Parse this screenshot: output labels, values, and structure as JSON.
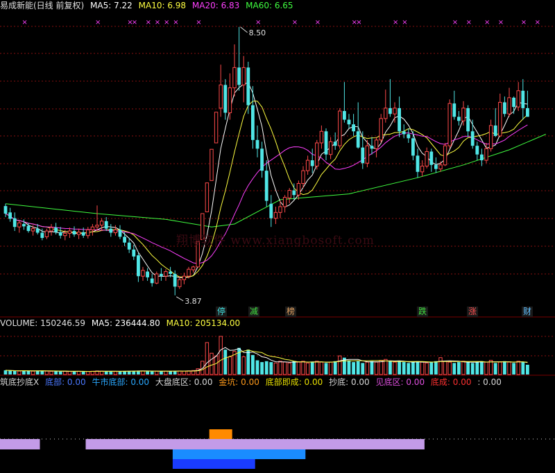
{
  "header1": {
    "name": "易成新能(日线 前复权)",
    "ma5": "MA5: 7.22",
    "ma10": "MA10: 6.98",
    "ma20": "MA20: 6.83",
    "ma60": "MA60: 6.65"
  },
  "header2": {
    "volume": "VOLUME: 150246.59",
    "ma5": "MA5: 236444.80",
    "ma10": "MA10: 205134.00"
  },
  "header3": [
    {
      "text": "筑底抄底X",
      "color": "#d8d8d8"
    },
    {
      "text": "底部: 0.00",
      "color": "#4a78ff"
    },
    {
      "text": "牛市底部: 0.00",
      "color": "#2aa8ff"
    },
    {
      "text": "大盘底区: 0.00",
      "color": "#d8d8d8"
    },
    {
      "text": "金坑: 0.00",
      "color": "#ff9a1a"
    },
    {
      "text": "底部即成: 0.00",
      "color": "#e8e000"
    },
    {
      "text": "抄底: 0.00",
      "color": "#d8d8d8"
    },
    {
      "text": "见底区: 0.00",
      "color": "#e050e0"
    },
    {
      "text": "底成: 0.00",
      "color": "#ff3030"
    },
    {
      "text": ": 0.00",
      "color": "#d8d8d8"
    }
  ],
  "watermark": "翔博软件 www.xiangbosoft.com",
  "annotations": {
    "high": "8.50",
    "low": "3.87"
  },
  "tags": [
    {
      "text": "停",
      "color": "#40e0e0"
    },
    {
      "text": "减",
      "color": "#40e040"
    },
    {
      "text": "榜",
      "color": "#e0a060"
    },
    {
      "text": "跌",
      "color": "#40e040"
    },
    {
      "text": "涨",
      "color": "#ff5050"
    },
    {
      "text": "财",
      "color": "#60c0ff"
    }
  ],
  "colors": {
    "up": "#ff4a4a",
    "down": "#50e6e6",
    "ma5": "#ffffff",
    "ma10": "#ffff40",
    "ma20": "#ff40ff",
    "ma60": "#40ff40",
    "grid": "#8a1010",
    "lavender": "#c39be8",
    "orange": "#ff8a00",
    "blue1": "#1a8cff",
    "blue2": "#1a3cff"
  },
  "chart_data": {
    "type": "candlestick",
    "title": "易成新能(日线 前复权)",
    "high_label": 8.5,
    "low_label": 3.87,
    "ylim": [
      3.7,
      8.75
    ],
    "candles": [
      [
        5.41,
        5.45,
        5.22,
        5.28
      ],
      [
        5.3,
        5.38,
        5.14,
        5.19
      ],
      [
        5.2,
        5.3,
        4.98,
        5.05
      ],
      [
        5.05,
        5.16,
        4.95,
        5.12
      ],
      [
        5.1,
        5.18,
        5.0,
        5.06
      ],
      [
        5.07,
        5.12,
        4.95,
        4.98
      ],
      [
        4.98,
        5.08,
        4.9,
        5.02
      ],
      [
        5.02,
        5.1,
        4.92,
        4.95
      ],
      [
        4.95,
        5.02,
        4.82,
        4.86
      ],
      [
        4.88,
        5.02,
        4.84,
        4.98
      ],
      [
        4.98,
        5.1,
        4.9,
        5.04
      ],
      [
        5.04,
        5.12,
        4.92,
        4.96
      ],
      [
        4.96,
        5.05,
        4.85,
        4.9
      ],
      [
        4.9,
        5.0,
        4.82,
        4.94
      ],
      [
        4.94,
        5.04,
        4.86,
        4.98
      ],
      [
        4.98,
        5.06,
        4.88,
        4.92
      ],
      [
        4.92,
        5.02,
        4.84,
        4.96
      ],
      [
        4.96,
        5.04,
        4.86,
        4.9
      ],
      [
        4.9,
        5.05,
        4.85,
        5.0
      ],
      [
        5.0,
        5.1,
        4.9,
        5.05
      ],
      [
        5.05,
        5.42,
        4.98,
        5.08
      ],
      [
        5.08,
        5.2,
        4.98,
        5.15
      ],
      [
        5.15,
        5.22,
        4.98,
        5.02
      ],
      [
        5.02,
        5.1,
        4.88,
        4.95
      ],
      [
        4.95,
        5.08,
        4.9,
        5.0
      ],
      [
        5.0,
        5.08,
        4.84,
        4.88
      ],
      [
        4.88,
        4.96,
        4.72,
        4.78
      ],
      [
        4.78,
        4.86,
        4.6,
        4.66
      ],
      [
        4.66,
        4.74,
        4.48,
        4.54
      ],
      [
        4.56,
        4.6,
        4.1,
        4.2
      ],
      [
        4.2,
        4.36,
        4.12,
        4.3
      ],
      [
        4.28,
        4.34,
        4.12,
        4.18
      ],
      [
        4.16,
        4.24,
        4.02,
        4.08
      ],
      [
        4.08,
        4.28,
        4.06,
        4.24
      ],
      [
        4.24,
        4.34,
        4.12,
        4.2
      ],
      [
        4.2,
        4.32,
        4.12,
        4.28
      ],
      [
        4.28,
        4.36,
        4.18,
        4.24
      ],
      [
        4.24,
        4.3,
        3.87,
        4.02
      ],
      [
        4.02,
        4.2,
        3.98,
        4.14
      ],
      [
        4.14,
        4.26,
        4.06,
        4.2
      ],
      [
        4.2,
        4.36,
        4.16,
        4.32
      ],
      [
        4.31,
        4.38,
        4.26,
        4.36
      ],
      [
        4.36,
        4.8,
        4.35,
        4.8
      ],
      [
        4.83,
        5.28,
        4.83,
        5.28
      ],
      [
        5.31,
        5.81,
        5.31,
        5.81
      ],
      [
        5.85,
        6.39,
        5.85,
        6.39
      ],
      [
        6.5,
        7.03,
        6.5,
        7.03
      ],
      [
        7.1,
        7.85,
        6.95,
        7.5
      ],
      [
        7.5,
        7.6,
        6.9,
        7.02
      ],
      [
        7.02,
        7.7,
        6.9,
        7.45
      ],
      [
        7.45,
        8.2,
        7.3,
        7.8
      ],
      [
        7.8,
        8.5,
        7.4,
        7.5
      ],
      [
        7.5,
        8.0,
        7.2,
        7.8
      ],
      [
        7.8,
        7.9,
        7.0,
        7.15
      ],
      [
        7.15,
        7.48,
        6.4,
        6.55
      ],
      [
        6.55,
        6.8,
        6.25,
        6.4
      ],
      [
        6.4,
        6.52,
        5.9,
        6.02
      ],
      [
        6.02,
        6.2,
        5.4,
        5.5
      ],
      [
        5.45,
        5.6,
        5.05,
        5.2
      ],
      [
        5.2,
        5.4,
        5.1,
        5.3
      ],
      [
        5.3,
        5.5,
        5.2,
        5.4
      ],
      [
        5.4,
        5.6,
        5.3,
        5.56
      ],
      [
        5.55,
        5.72,
        5.46,
        5.68
      ],
      [
        5.68,
        5.8,
        5.52,
        5.6
      ],
      [
        5.6,
        5.85,
        5.52,
        5.8
      ],
      [
        5.8,
        6.1,
        5.72,
        6.02
      ],
      [
        6.02,
        6.28,
        5.95,
        6.2
      ],
      [
        6.2,
        6.4,
        5.98,
        6.1
      ],
      [
        6.1,
        6.55,
        6.04,
        6.5
      ],
      [
        6.5,
        6.8,
        6.4,
        6.7
      ],
      [
        6.7,
        6.75,
        6.2,
        6.3
      ],
      [
        6.3,
        6.6,
        6.22,
        6.52
      ],
      [
        6.52,
        6.68,
        6.38,
        6.45
      ],
      [
        6.45,
        7.1,
        6.4,
        7.05
      ],
      [
        7.05,
        7.55,
        6.85,
        6.9
      ],
      [
        6.9,
        7.0,
        6.75,
        6.82
      ],
      [
        6.82,
        7.0,
        6.62,
        6.7
      ],
      [
        6.7,
        7.2,
        6.4,
        6.42
      ],
      [
        6.42,
        6.7,
        6.05,
        6.15
      ],
      [
        6.15,
        6.55,
        6.08,
        6.45
      ],
      [
        6.45,
        6.6,
        6.3,
        6.4
      ],
      [
        6.4,
        6.6,
        6.25,
        6.55
      ],
      [
        6.55,
        7.0,
        6.5,
        6.92
      ],
      [
        6.92,
        7.42,
        6.85,
        7.1
      ],
      [
        7.1,
        7.6,
        6.95,
        7.0
      ],
      [
        7.0,
        7.2,
        6.85,
        7.1
      ],
      [
        7.1,
        7.3,
        6.6,
        6.7
      ],
      [
        6.7,
        6.82,
        6.58,
        6.65
      ],
      [
        6.65,
        6.75,
        6.5,
        6.58
      ],
      [
        6.58,
        6.7,
        6.2,
        6.28
      ],
      [
        6.28,
        6.4,
        5.9,
        6.0
      ],
      [
        6.0,
        6.2,
        5.92,
        6.1
      ],
      [
        6.1,
        6.42,
        6.06,
        6.35
      ],
      [
        6.35,
        6.4,
        6.0,
        6.12
      ],
      [
        6.12,
        6.25,
        5.98,
        6.05
      ],
      [
        6.05,
        6.18,
        6.0,
        6.12
      ],
      [
        6.12,
        6.5,
        6.1,
        6.45
      ],
      [
        6.45,
        7.25,
        6.4,
        7.18
      ],
      [
        7.18,
        7.4,
        6.9,
        6.95
      ],
      [
        6.95,
        7.05,
        6.8,
        6.88
      ],
      [
        6.88,
        7.22,
        6.8,
        7.1
      ],
      [
        7.1,
        7.15,
        6.6,
        6.7
      ],
      [
        6.7,
        6.9,
        6.4,
        6.45
      ],
      [
        6.45,
        6.52,
        6.2,
        6.3
      ],
      [
        6.3,
        6.4,
        6.1,
        6.2
      ],
      [
        6.2,
        6.5,
        6.15,
        6.4
      ],
      [
        6.4,
        6.9,
        6.35,
        6.8
      ],
      [
        6.8,
        7.1,
        6.6,
        6.62
      ],
      [
        6.62,
        7.35,
        6.6,
        7.2
      ],
      [
        7.2,
        7.3,
        6.95,
        7.0
      ],
      [
        7.0,
        7.45,
        6.95,
        7.28
      ],
      [
        7.28,
        7.3,
        7.0,
        7.12
      ],
      [
        7.12,
        7.55,
        7.05,
        7.4
      ],
      [
        7.4,
        7.6,
        6.9,
        7.1
      ],
      [
        7.1,
        7.4,
        7.0,
        6.95
      ]
    ],
    "ma60_points": [
      [
        0,
        5.45
      ],
      [
        20,
        5.28
      ],
      [
        35,
        5.18
      ],
      [
        45,
        5.05
      ],
      [
        50,
        5.1
      ],
      [
        60,
        5.52
      ],
      [
        75,
        5.62
      ],
      [
        90,
        5.9
      ],
      [
        100,
        6.12
      ],
      [
        110,
        6.38
      ],
      [
        118,
        6.65
      ]
    ],
    "volume": {
      "label": "VOLUME",
      "last": 150246.59,
      "ma5": 236444.8,
      "ma10": 205134.0,
      "ymax": 1000,
      "values": [
        95,
        85,
        80,
        78,
        90,
        82,
        75,
        80,
        88,
        76,
        72,
        70,
        68,
        74,
        70,
        66,
        72,
        68,
        70,
        74,
        80,
        76,
        72,
        70,
        68,
        74,
        78,
        80,
        82,
        86,
        78,
        72,
        70,
        74,
        72,
        76,
        78,
        84,
        80,
        76,
        82,
        90,
        130,
        300,
        720,
        480,
        420,
        860,
        560,
        400,
        520,
        600,
        400,
        560,
        440,
        320,
        280,
        300,
        280,
        260,
        300,
        280,
        260,
        300,
        280,
        300,
        260,
        280,
        300,
        280,
        260,
        280,
        300,
        420,
        380,
        320,
        280,
        300,
        260,
        280,
        300,
        280,
        320,
        340,
        300,
        280,
        300,
        280,
        260,
        280,
        300,
        280,
        260,
        280,
        300,
        380,
        300,
        280,
        260,
        280,
        300,
        280,
        260,
        280,
        300,
        280,
        320,
        260,
        280,
        300,
        280,
        260,
        300,
        280,
        220
      ]
    },
    "cross_markers": [
      4,
      20,
      27,
      28,
      31,
      33,
      35,
      37,
      42,
      55,
      63,
      68,
      76,
      77,
      85,
      87,
      98,
      101,
      105,
      108,
      113,
      116
    ],
    "indicator": {
      "label": "筑底抄底X",
      "bars": [
        {
          "name": "lavender",
          "from": 0,
          "to": 7,
          "value": 1
        },
        {
          "name": "lavender",
          "from": 18,
          "to": 91,
          "value": 1
        },
        {
          "name": "orange",
          "from": 45,
          "to": 49,
          "value": 2
        },
        {
          "name": "blue1",
          "from": 37,
          "to": 65,
          "value": 1
        },
        {
          "name": "blue2",
          "from": 37,
          "to": 54,
          "value": 1
        }
      ]
    }
  }
}
